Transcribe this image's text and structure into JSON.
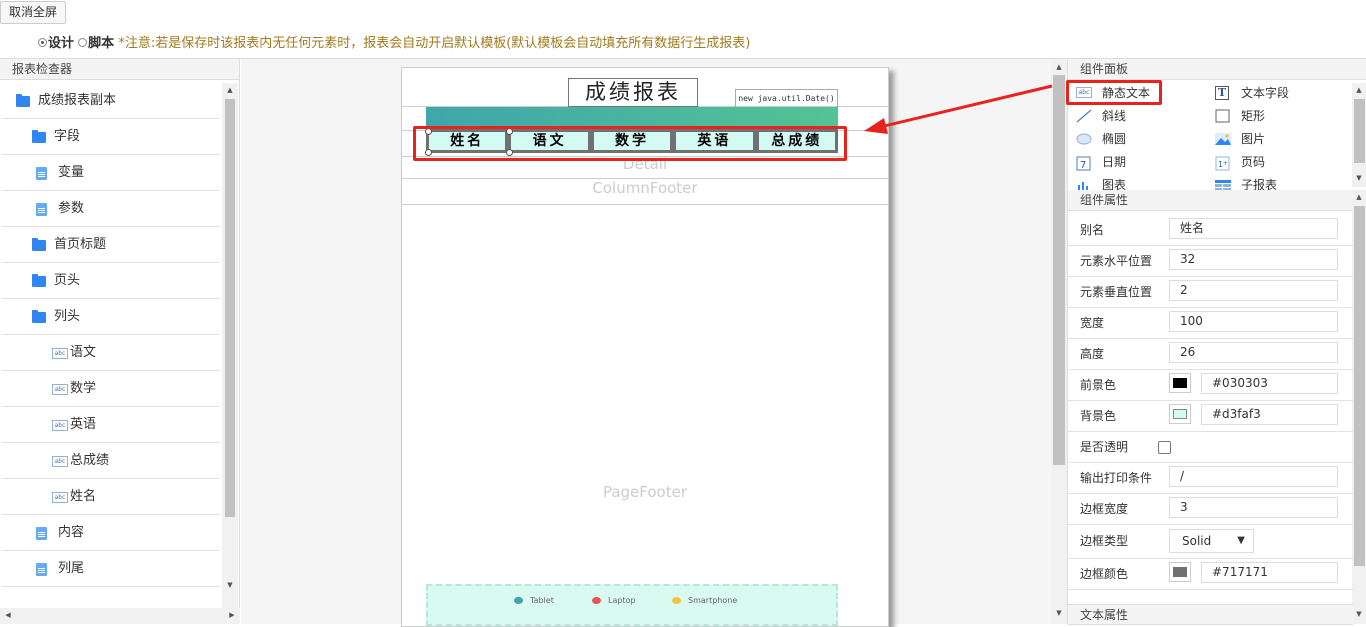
{
  "toolbar": {
    "fullscreen_label": "取消全屏"
  },
  "mode": {
    "design_label": "设计",
    "script_label": "脚本",
    "note": "*注意:若是保存时该报表内无任何元素时，报表会自动开启默认模板(默认模板会自动填充所有数据行生成报表)"
  },
  "inspector": {
    "title": "报表检查器",
    "items": [
      {
        "label": "成绩报表副本",
        "icon": "folder-open-icon"
      },
      {
        "label": "字段",
        "icon": "folder-icon"
      },
      {
        "label": "变量",
        "icon": "document-icon"
      },
      {
        "label": "参数",
        "icon": "document-icon"
      },
      {
        "label": "首页标题",
        "icon": "folder-icon"
      },
      {
        "label": "页头",
        "icon": "folder-icon"
      },
      {
        "label": "列头",
        "icon": "folder-open-icon"
      },
      {
        "label": "语文",
        "icon": "abc-text-icon"
      },
      {
        "label": "数学",
        "icon": "abc-text-icon"
      },
      {
        "label": "英语",
        "icon": "abc-text-icon"
      },
      {
        "label": "总成绩",
        "icon": "abc-text-icon"
      },
      {
        "label": "姓名",
        "icon": "abc-text-icon"
      },
      {
        "label": "内容",
        "icon": "document-icon"
      },
      {
        "label": "列尾",
        "icon": "document-icon"
      }
    ]
  },
  "canvas": {
    "report_title": "成绩报表",
    "date_expr": "new java.util.Date()",
    "columns": [
      "姓名",
      "语文",
      "数学",
      "英语",
      "总成绩"
    ],
    "band_detail": "Detail",
    "band_column_footer": "ColumnFooter",
    "band_page_footer": "PageFooter",
    "chart_legend": [
      "Tablet",
      "Laptop",
      "Smartphone"
    ],
    "colors": {
      "tablet": "#45a0aa",
      "laptop": "#e8534f",
      "smartphone": "#f2c440"
    }
  },
  "components": {
    "title": "组件面板",
    "items": [
      {
        "label": "静态文本",
        "icon": "static-text-icon"
      },
      {
        "label": "文本字段",
        "icon": "text-field-icon"
      },
      {
        "label": "斜线",
        "icon": "line-icon"
      },
      {
        "label": "矩形",
        "icon": "rectangle-icon"
      },
      {
        "label": "椭圆",
        "icon": "ellipse-icon"
      },
      {
        "label": "图片",
        "icon": "image-icon"
      },
      {
        "label": "日期",
        "icon": "calendar-icon"
      },
      {
        "label": "页码",
        "icon": "page-number-icon"
      },
      {
        "label": "图表",
        "icon": "chart-icon"
      },
      {
        "label": "子报表",
        "icon": "subreport-icon"
      }
    ]
  },
  "properties": {
    "title": "组件属性",
    "alias_label": "别名",
    "alias": "姓名",
    "x_label": "元素水平位置",
    "x": "32",
    "y_label": "元素垂直位置",
    "y": "2",
    "width_label": "宽度",
    "width": "100",
    "height_label": "高度",
    "height": "26",
    "fg_label": "前景色",
    "fg": "#030303",
    "bg_label": "背景色",
    "bg": "#d3faf3",
    "transparent_label": "是否透明",
    "print_cond_label": "输出打印条件",
    "print_cond": "/",
    "border_width_label": "边框宽度",
    "border_width": "3",
    "border_type_label": "边框类型",
    "border_type": "Solid",
    "border_color_label": "边框颜色",
    "border_color": "#717171",
    "text_props_title": "文本属性"
  }
}
